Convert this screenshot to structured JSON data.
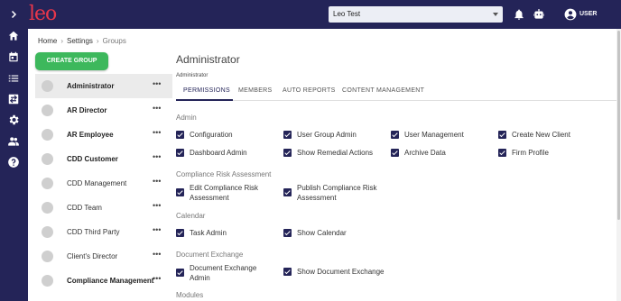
{
  "colors": {
    "topbar": "#242458",
    "accent_green": "#3db85c",
    "logo": "#e8374b",
    "checkbox": "#242458"
  },
  "app": {
    "logo": "leo"
  },
  "header": {
    "environment_select": "Leo Test",
    "user_label": "USER",
    "icons": [
      "bell-icon",
      "robot-icon",
      "account-circle-icon"
    ]
  },
  "rail": {
    "icons": [
      "chevron-right-icon",
      "home-icon",
      "calendar-icon",
      "list-icon",
      "exchange-icon",
      "settings-icon",
      "people-icon",
      "help-icon"
    ]
  },
  "breadcrumb": {
    "home": "Home",
    "sep": "›",
    "settings": "Settings",
    "groups": "Groups"
  },
  "create_button": "CREATE GROUP",
  "groups": [
    {
      "name": "Administrator",
      "selected": true
    },
    {
      "name": "AR Director"
    },
    {
      "name": "AR Employee"
    },
    {
      "name": "CDD Customer"
    },
    {
      "name": "CDD Management"
    },
    {
      "name": "CDD Team"
    },
    {
      "name": "CDD Third Party"
    },
    {
      "name": "Client's Director"
    },
    {
      "name": "Compliance Management"
    }
  ],
  "group_more": "•••",
  "pane": {
    "title": "Administrator",
    "subtitle": "Administrator",
    "tabs": [
      "PERMISSIONS",
      "MEMBERS",
      "AUTO REPORTS",
      "CONTENT MANAGEMENT"
    ],
    "active_tab": "PERMISSIONS"
  },
  "sections": {
    "admin": {
      "title": "Admin",
      "items": [
        "Configuration",
        "User Group Admin",
        "User Management",
        "Create New Client",
        "Dashboard Admin",
        "Show Remedial Actions",
        "Archive Data",
        "Firm Profile"
      ]
    },
    "compliance": {
      "title": "Compliance Risk Assessment",
      "items": [
        "Edit Compliance Risk Assessment",
        "Publish Compliance Risk Assessment"
      ]
    },
    "calendar": {
      "title": "Calendar",
      "items": [
        "Task Admin",
        "Show Calendar"
      ]
    },
    "documents": {
      "title": "Document Exchange",
      "items": [
        "Document Exchange Admin",
        "Show Document Exchange"
      ]
    },
    "modules": {
      "title": "Modules"
    }
  }
}
